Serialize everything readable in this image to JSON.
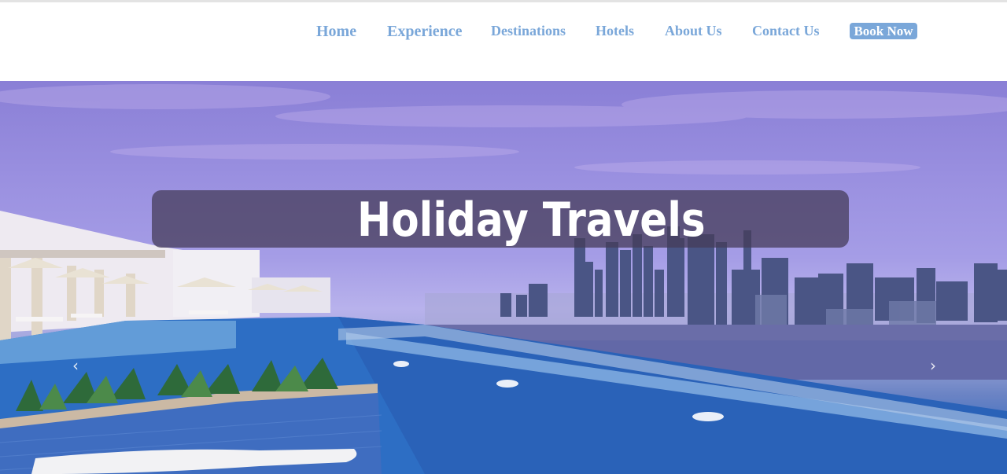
{
  "nav": {
    "items": [
      {
        "label": "Home"
      },
      {
        "label": "Experience"
      },
      {
        "label": "Destinations"
      },
      {
        "label": "Hotels"
      },
      {
        "label": "About Us"
      },
      {
        "label": "Contact Us"
      }
    ],
    "book_label": "Book Now",
    "link_color": "#7aa7d9"
  },
  "hero": {
    "title": "Holiday Travels",
    "prev_icon": "chevron-left-icon",
    "next_icon": "chevron-right-icon",
    "prev_glyph": "‹",
    "next_glyph": "›"
  }
}
